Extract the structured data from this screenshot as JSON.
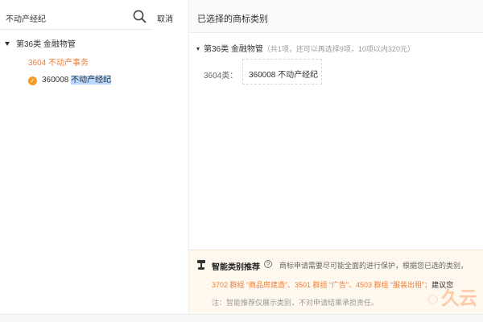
{
  "search": {
    "value": "不动产经纪",
    "cancel_label": "取消"
  },
  "tree": {
    "category": "第36类 金融物管",
    "group": "3604 不动产事务",
    "item_code": "360008",
    "item_name": "不动产经纪",
    "check_icon": "checkmark-icon"
  },
  "selected": {
    "title": "已选择的商标类别",
    "category": "第36类 金融物管",
    "category_note": "（共1项，还可以再选择9项，10项以内320元）",
    "class_label": "3604类：",
    "chip": "360008 不动产经纪"
  },
  "recommend": {
    "title": "智能类别推荐",
    "help_icon": "question-icon",
    "description": "商标申请需要尽可能全面的进行保护，根据您已选的类别，",
    "suggestion": "3702 群组 “商品房建造”、3501 群组 “广告”、4503 群组 “服装出租”；",
    "advice": "建议您",
    "note": "注：智能推荐仅展示类别，不对申请结果承担责任。"
  },
  "watermark": "久云",
  "colors": {
    "accent": "#ee7e38",
    "check": "#f59a23",
    "highlight": "#b8d7ff"
  }
}
